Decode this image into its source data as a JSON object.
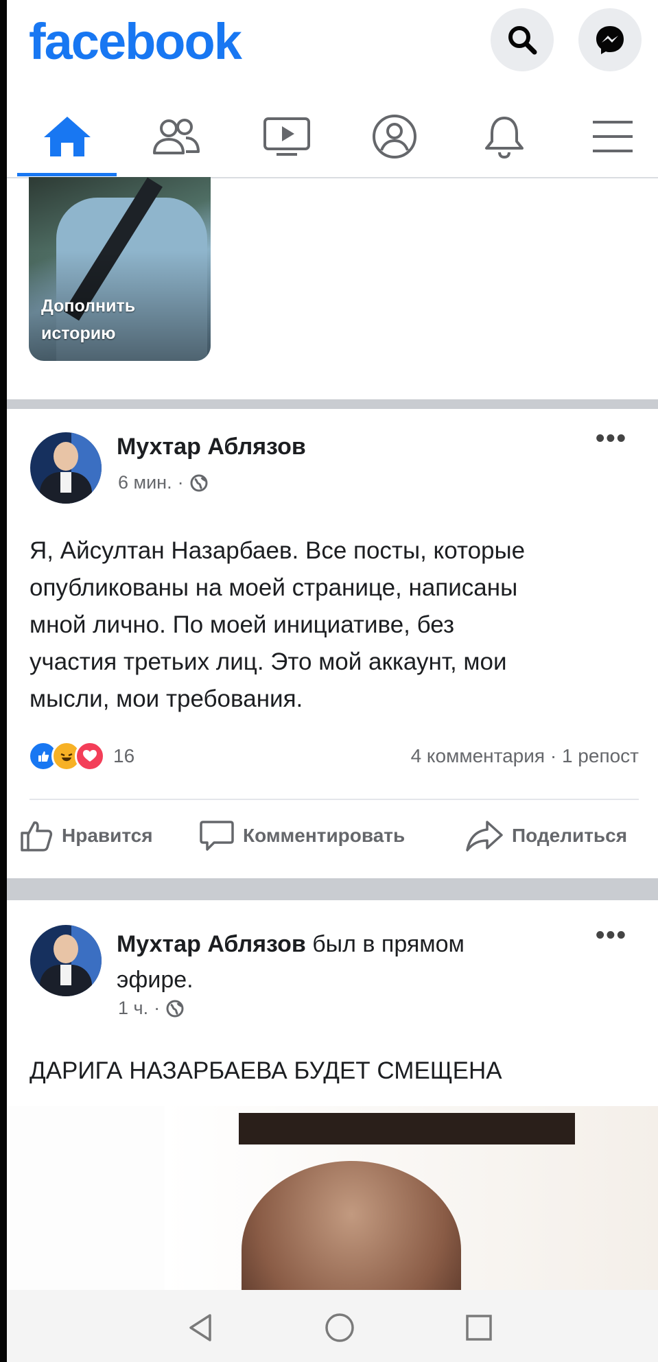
{
  "app": {
    "logo": "facebook",
    "brand_color": "#1877f2"
  },
  "header": {
    "search_icon": "search-icon",
    "messenger_icon": "messenger-icon"
  },
  "tabs": [
    {
      "name": "home",
      "icon": "home-icon",
      "active": true
    },
    {
      "name": "friends",
      "icon": "friends-icon",
      "active": false
    },
    {
      "name": "watch",
      "icon": "video-icon",
      "active": false
    },
    {
      "name": "profile",
      "icon": "profile-icon",
      "active": false
    },
    {
      "name": "notifications",
      "icon": "bell-icon",
      "active": false
    },
    {
      "name": "menu",
      "icon": "hamburger-menu-icon",
      "active": false
    }
  ],
  "story": {
    "label_line1": "Дополнить",
    "label_line2": "историю"
  },
  "post1": {
    "author": "Мухтар Аблязов",
    "time": "6 мин.",
    "privacy_icon": "globe-icon",
    "text_lines": [
      "Я, Айсултан Назарбаев. Все посты, которые",
      "опубликованы на моей странице,  написаны",
      "мной лично. По моей инициативе,  без",
      "участия третьих лиц. Это мой аккаунт, мои",
      "мысли, мои требования."
    ],
    "reactions": [
      "like",
      "haha",
      "love"
    ],
    "reaction_count": "16",
    "comments_shares": "4 комментария · 1 репост",
    "actions": {
      "like": "Нравится",
      "comment": "Комментировать",
      "share": "Поделиться"
    }
  },
  "post2": {
    "author": "Мухтар Аблязов",
    "suffix_line1": " был в прямом",
    "suffix_line2": "эфире.",
    "time": "1 ч.",
    "privacy_icon": "globe-icon",
    "headline": "ДАРИГА НАЗАРБАЕВА БУДЕТ СМЕЩЕНА"
  },
  "system_nav": {
    "back": "back-triangle-icon",
    "home": "home-circle-icon",
    "recents": "recents-square-icon"
  }
}
